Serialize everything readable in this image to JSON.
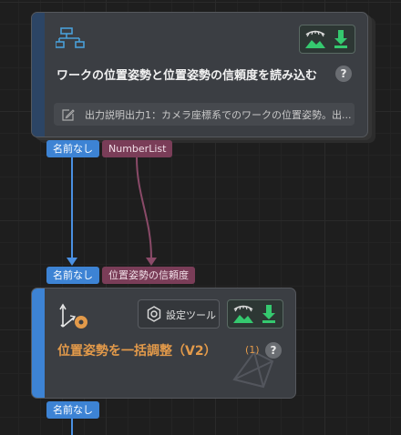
{
  "node1": {
    "title": "ワークの位置姿勢と位置姿勢の信頼度を読み込む",
    "description": "出力説明出力1：カメラ座標系でのワークの位置姿勢。出...",
    "icon": "flowchart-icon",
    "help_label": "?",
    "output_ports": [
      "名前なし",
      "NumberList"
    ]
  },
  "node2": {
    "title": "位置姿勢を一括調整（V2）",
    "count": "(1)",
    "help_label": "?",
    "settings_label": "設定ツール",
    "input_ports": [
      "名前なし",
      "位置姿勢の信頼度"
    ],
    "output_ports": [
      "名前なし"
    ],
    "icon": "axes-pose-icon"
  },
  "colors": {
    "accent_blue": "#3d83d4",
    "port_mauve": "#7a3d58",
    "title_orange": "#e39a4a",
    "run_green": "#35c96f"
  }
}
